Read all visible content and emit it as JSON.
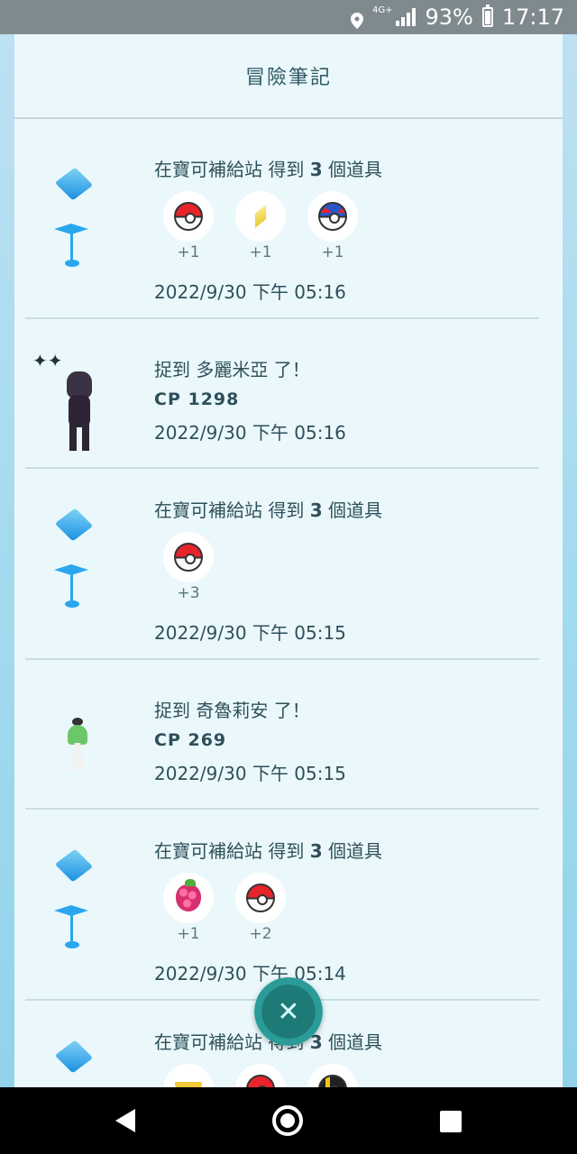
{
  "status_bar": {
    "network": "4G+",
    "battery": "93%",
    "time": "17:17"
  },
  "header": {
    "title": "冒險筆記"
  },
  "entries": [
    {
      "type": "pokestop",
      "text_prefix": "在寶可補給站  得到 ",
      "count": "3",
      "text_suffix": " 個道具",
      "items": [
        {
          "icon": "poke-ball-icon",
          "count": "+1"
        },
        {
          "icon": "stardust-icon",
          "count": "+1"
        },
        {
          "icon": "great-ball-icon",
          "count": "+1"
        }
      ],
      "timestamp": "2022/9/30 下午 05:16"
    },
    {
      "type": "catch",
      "text_prefix": "捉到 ",
      "pokemon": "多麗米亞",
      "text_suffix": " 了！",
      "cp": "CP 1298",
      "timestamp": "2022/9/30 下午 05:16"
    },
    {
      "type": "pokestop",
      "text_prefix": "在寶可補給站  得到 ",
      "count": "3",
      "text_suffix": " 個道具",
      "items": [
        {
          "icon": "poke-ball-icon",
          "count": "+3"
        }
      ],
      "timestamp": "2022/9/30 下午 05:15"
    },
    {
      "type": "catch",
      "text_prefix": "捉到 ",
      "pokemon": "奇魯莉安",
      "text_suffix": " 了！",
      "cp": "CP 269",
      "timestamp": "2022/9/30 下午 05:15"
    },
    {
      "type": "pokestop",
      "text_prefix": "在寶可補給站  得到 ",
      "count": "3",
      "text_suffix": " 個道具",
      "items": [
        {
          "icon": "razz-berry-icon",
          "count": "+1"
        },
        {
          "icon": "poke-ball-icon",
          "count": "+2"
        }
      ],
      "timestamp": "2022/9/30 下午 05:14"
    },
    {
      "type": "pokestop",
      "text_prefix": "在寶可補給站  得到 ",
      "count": "3",
      "text_suffix": " 個道具",
      "items": [
        {
          "icon": "banana-icon",
          "count": ""
        },
        {
          "icon": "poke-ball-icon",
          "count": ""
        },
        {
          "icon": "ultra-ball-icon",
          "count": ""
        }
      ],
      "timestamp": ""
    }
  ],
  "colors": {
    "accent": "#2aa6ee",
    "close_button": "#1e7a77",
    "panel_bg": "#eaf8fc"
  }
}
